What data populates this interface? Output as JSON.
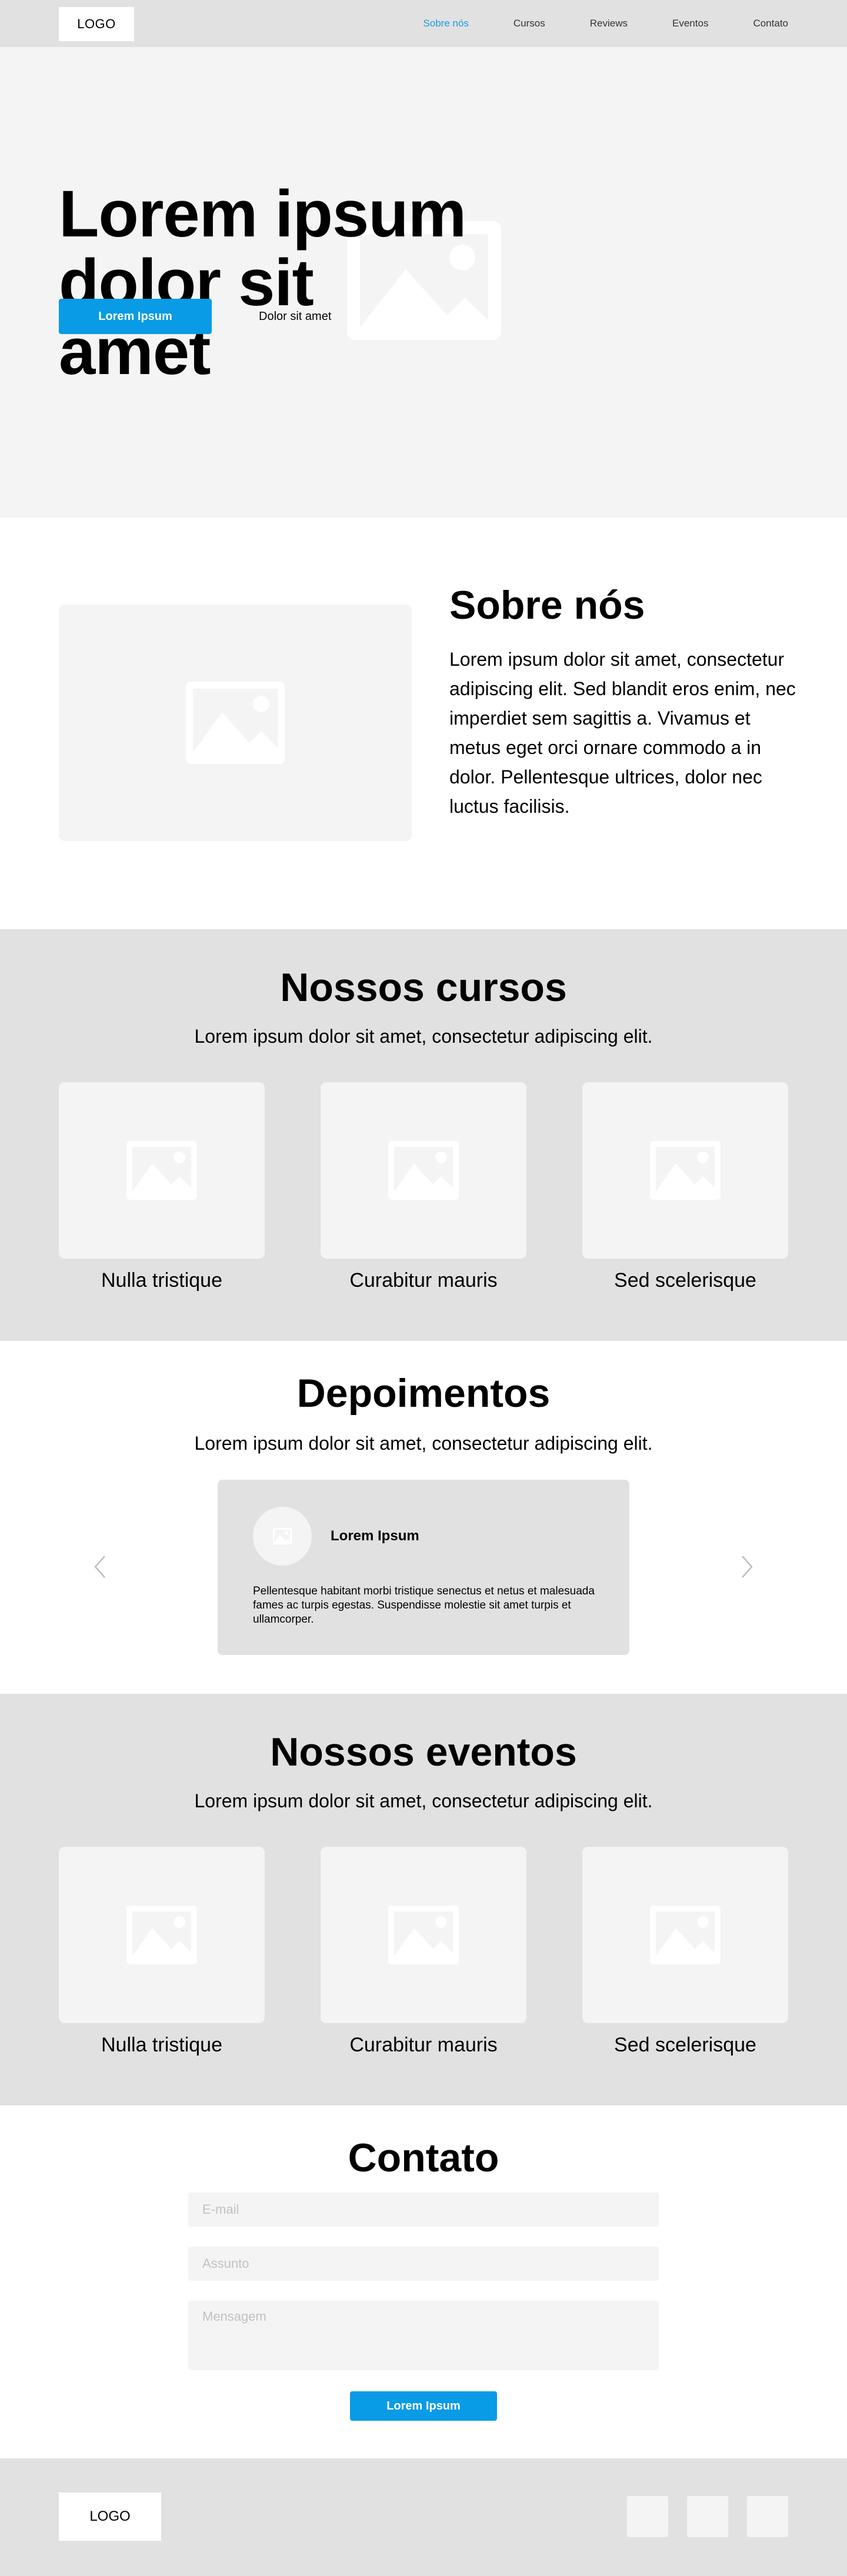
{
  "header": {
    "logo": "LOGO",
    "nav": [
      {
        "label": "Sobre nós",
        "active": true
      },
      {
        "label": "Cursos",
        "active": false
      },
      {
        "label": "Reviews",
        "active": false
      },
      {
        "label": "Eventos",
        "active": false
      },
      {
        "label": "Contato",
        "active": false
      }
    ]
  },
  "hero": {
    "title": "Lorem ipsum dolor sit amet",
    "primary_button": "Lorem Ipsum",
    "secondary_link": "Dolor sit amet"
  },
  "about": {
    "title": "Sobre nós",
    "text": "Lorem ipsum dolor sit amet, consectetur adipiscing elit. Sed blandit eros enim, nec imperdiet sem sagittis a. Vivamus et metus eget orci ornare commodo a in dolor. Pellentesque ultrices, dolor nec luctus facilisis."
  },
  "courses": {
    "title": "Nossos cursos",
    "subtitle": "Lorem ipsum dolor sit amet, consectetur adipiscing elit.",
    "items": [
      {
        "label": "Nulla tristique"
      },
      {
        "label": "Curabitur mauris"
      },
      {
        "label": "Sed scelerisque"
      }
    ]
  },
  "testimonials": {
    "title": "Depoimentos",
    "subtitle": "Lorem ipsum dolor sit amet, consectetur adipiscing elit.",
    "card": {
      "name": "Lorem Ipsum",
      "text": "Pellentesque habitant morbi tristique senectus et netus et malesuada fames ac turpis egestas. Suspendisse molestie sit amet turpis et ullamcorper."
    }
  },
  "events": {
    "title": "Nossos eventos",
    "subtitle": "Lorem ipsum dolor sit amet, consectetur adipiscing elit.",
    "items": [
      {
        "label": "Nulla tristique"
      },
      {
        "label": "Curabitur mauris"
      },
      {
        "label": "Sed scelerisque"
      }
    ]
  },
  "contact": {
    "title": "Contato",
    "email_placeholder": "E-mail",
    "subject_placeholder": "Assunto",
    "message_placeholder": "Mensagem",
    "submit": "Lorem Ipsum"
  },
  "footer": {
    "logo": "LOGO"
  },
  "colors": {
    "accent": "#099be5",
    "gray_section": "#e1e1e1",
    "placeholder": "#f4f4f4"
  }
}
